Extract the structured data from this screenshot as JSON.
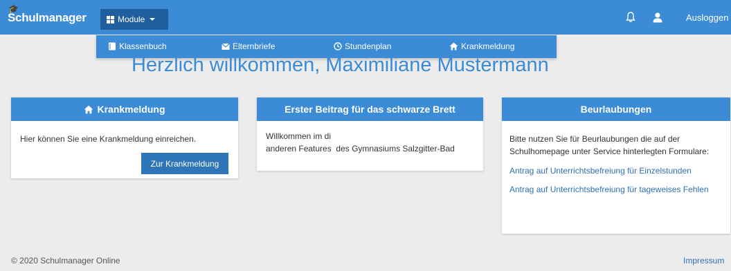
{
  "navbar": {
    "brand": "Schulmanager",
    "module_label": "Module",
    "logout_label": "Ausloggen"
  },
  "dropdown": {
    "items": [
      {
        "label": "Klassenbuch",
        "icon": "book-icon"
      },
      {
        "label": "Elternbriefe",
        "icon": "envelope-icon"
      },
      {
        "label": "Stundenplan",
        "icon": "clock-icon"
      },
      {
        "label": "Krankmeldung",
        "icon": "home-icon"
      }
    ]
  },
  "welcome": "Herzlich willkommen, Maximiliane Mustermann",
  "panels": {
    "sick": {
      "title": "Krankmeldung",
      "text": "Hier können Sie eine Krankmeldung einreichen.",
      "button": "Zur Krankmeldung"
    },
    "board": {
      "title": "Erster Beitrag für das schwarze Brett",
      "line1": "Willkommen im di",
      "line2": "anderen Features  des Gymnasiums Salzgitter-Bad"
    },
    "leave": {
      "title": "Beurlaubungen",
      "text": "Bitte nutzen Sie für Beurlaubungen die auf der Schulhomepage unter Service hinterlegten Formulare:",
      "link1": "Antrag auf Unterrichtsbefreiung für Einzelstunden",
      "link2": "Antrag auf Unterrichtsbefreiung für tageweises Fehlen"
    }
  },
  "footer": {
    "copyright": "© 2020 Schulmanager Online",
    "imprint": "Impressum"
  },
  "colors": {
    "primary": "#3c8bd6",
    "module_active": "#1f5f9e",
    "button": "#2e76b7",
    "link": "#2f6fb4",
    "background": "#ececec"
  }
}
